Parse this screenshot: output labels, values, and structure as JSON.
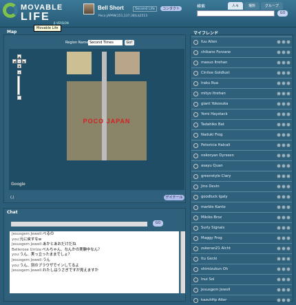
{
  "brand": {
    "line1": "MOVABLE",
    "line2": "LIFE",
    "beta": "β VERSION",
    "tooltip": "Movable Life"
  },
  "profile": {
    "name": "Bell Short",
    "platform": "Second Life",
    "contact_label": "コンタクト",
    "location": "Poco JAPAN(151,137,38)L$2513"
  },
  "search": {
    "label": "検索",
    "tabs": [
      "人々",
      "場所",
      "グループ"
    ],
    "button": "GO"
  },
  "map": {
    "title": "Map",
    "region_label": "Region Name",
    "region_value": "Second Times",
    "go_label": "Go!",
    "banner": "POCO JAPAN",
    "google": "Google",
    "coords": "(,)",
    "detail_label": "デイテール"
  },
  "chat": {
    "title": "Chat",
    "send": "GO",
    "messages": [
      {
        "user": "Jesusgem Jewell:",
        "text": "べるの"
      },
      {
        "user": "you:",
        "text": "元に戻すなw"
      },
      {
        "user": "Jesusgem Jewell:",
        "text": "あかとあおだけだね"
      },
      {
        "user": "Bellerose Urriza:",
        "text": "べルちゃん、なんかの実験中なん？"
      },
      {
        "user": "you:",
        "text": "うん、実っ立ったままでしょ？"
      },
      {
        "user": "Jesusgem Jewell:",
        "text": "うん"
      },
      {
        "user": "you:",
        "text": "うん、別のブラウザでインしてるよ"
      },
      {
        "user": "Jesusgem Jewell:",
        "text": "わたしはうさぎですが見えますか"
      }
    ]
  },
  "friends": {
    "title": "マイフレンド",
    "items": [
      "fuu Allen",
      "chikane Forzane",
      "masuo Itrehan",
      "Cinilee Goldlust",
      "Iraku Rua",
      "mityo Itrehan",
      "giant Yokosuka",
      "Yomi Haystack",
      "Tadahiko Bat",
      "Naduki Frog",
      "Petoricia Halcali",
      "nekoryan Dyrssen",
      "asayu Quan",
      "greenstyle Clary",
      "Jino Devin",
      "goodluck Igaly",
      "marble Kanto",
      "Mikiko Broz",
      "Surly Signals",
      "Maggy Frog",
      "zukeran21 Alcht",
      "Itu Gecki",
      "shimizukun Oh",
      "Inui Sol",
      "Jesusgem Jewell",
      "kazuhHp Alter"
    ]
  },
  "colors": {
    "bg": "#2b5d78",
    "accent": "#7fc24a",
    "header": "#3c7897"
  }
}
